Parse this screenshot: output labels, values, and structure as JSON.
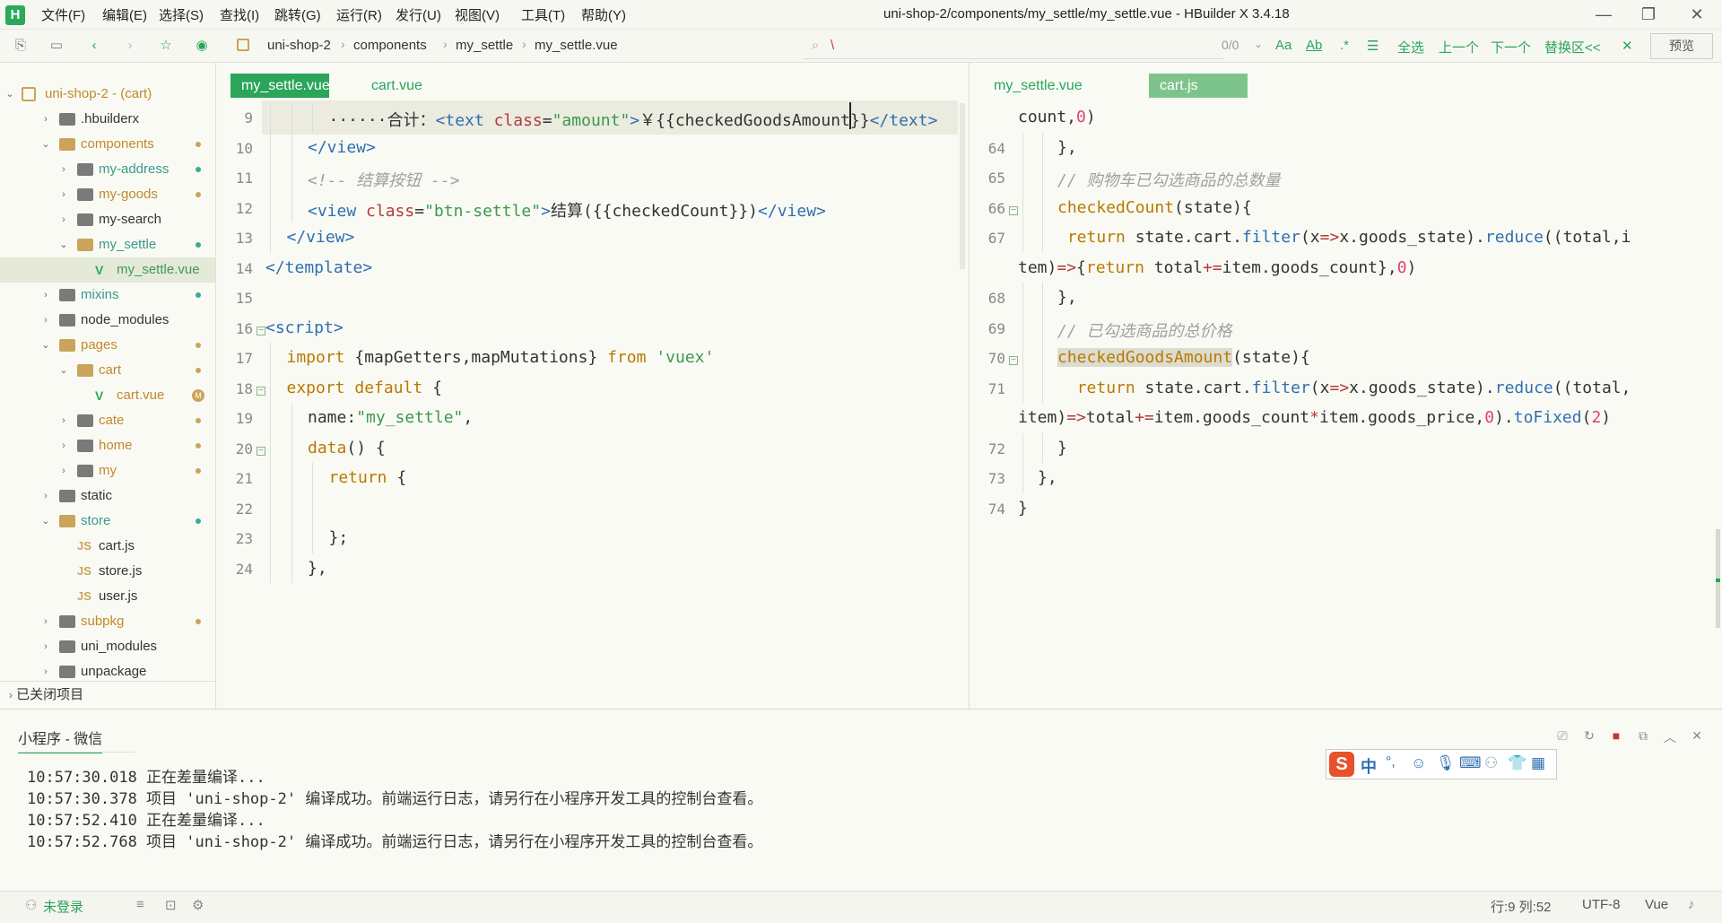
{
  "window": {
    "title": "uni-shop-2/components/my_settle/my_settle.vue - HBuilder X 3.4.18",
    "logo": "H",
    "menu": [
      "文件(F)",
      "编辑(E)",
      "选择(S)",
      "查找(I)",
      "跳转(G)",
      "运行(R)",
      "发行(U)",
      "视图(V)",
      "工具(T)",
      "帮助(Y)"
    ],
    "controls": {
      "minimize": "—",
      "maximize": "❐",
      "close": "✕"
    }
  },
  "toolbar": {
    "breadcrumb": [
      "uni-shop-2",
      "components",
      "my_settle",
      "my_settle.vue"
    ],
    "find": {
      "query": "\\",
      "count": "0/0",
      "case_label": "Aa",
      "word_label": "Ab",
      "regex_label": ".*",
      "select_all": "全选",
      "prev": "上一个",
      "next": "下一个",
      "replace_toggle": "替换区<<",
      "close": "✕"
    },
    "preview_label": "预览"
  },
  "sidebar": {
    "project": "uni-shop-2 - (cart)",
    "items": [
      {
        "label": ".hbuilderx",
        "type": "folder",
        "level": 1,
        "expanded": false,
        "dot": ""
      },
      {
        "label": "components",
        "type": "folder",
        "level": 1,
        "expanded": true,
        "dot": "#c9a45a",
        "color": "#c08a2a"
      },
      {
        "label": "my-address",
        "type": "folder",
        "level": 2,
        "expanded": false,
        "dot": "#3aaa9a",
        "color": "#3a9a8a"
      },
      {
        "label": "my-goods",
        "type": "folder",
        "level": 2,
        "expanded": false,
        "dot": "#c9a45a",
        "color": "#c08a2a"
      },
      {
        "label": "my-search",
        "type": "folder",
        "level": 2,
        "expanded": false,
        "dot": "",
        "color": "#333"
      },
      {
        "label": "my_settle",
        "type": "folder",
        "level": 2,
        "expanded": true,
        "dot": "#3aaa9a",
        "color": "#3a9a8a"
      },
      {
        "label": "my_settle.vue",
        "type": "vue",
        "level": 3,
        "dot": "",
        "color": "#3a9a5a",
        "selected": true
      },
      {
        "label": "mixins",
        "type": "folder",
        "level": 1,
        "expanded": false,
        "dot": "#3aaa9a",
        "color": "#3a9a8a"
      },
      {
        "label": "node_modules",
        "type": "folder",
        "level": 1,
        "expanded": false,
        "dot": "",
        "color": "#333"
      },
      {
        "label": "pages",
        "type": "folder",
        "level": 1,
        "expanded": true,
        "dot": "#c9a45a",
        "color": "#c08a2a"
      },
      {
        "label": "cart",
        "type": "folder",
        "level": 2,
        "expanded": true,
        "dot": "#c9a45a",
        "color": "#c08a2a"
      },
      {
        "label": "cart.vue",
        "type": "vue",
        "level": 3,
        "dot": "",
        "color": "#c08a2a",
        "badge": "M"
      },
      {
        "label": "cate",
        "type": "folder",
        "level": 2,
        "expanded": false,
        "dot": "#c9a45a",
        "color": "#c08a2a"
      },
      {
        "label": "home",
        "type": "folder",
        "level": 2,
        "expanded": false,
        "dot": "#c9a45a",
        "color": "#c08a2a"
      },
      {
        "label": "my",
        "type": "folder",
        "level": 2,
        "expanded": false,
        "dot": "#c9a45a",
        "color": "#c08a2a"
      },
      {
        "label": "static",
        "type": "folder",
        "level": 1,
        "expanded": false,
        "dot": "",
        "color": "#333"
      },
      {
        "label": "store",
        "type": "folder",
        "level": 1,
        "expanded": true,
        "dot": "#3aaa9a",
        "color": "#3a9a8a"
      },
      {
        "label": "cart.js",
        "type": "js",
        "level": 2,
        "dot": "",
        "color": "#333"
      },
      {
        "label": "store.js",
        "type": "js",
        "level": 2,
        "dot": "",
        "color": "#333"
      },
      {
        "label": "user.js",
        "type": "js",
        "level": 2,
        "dot": "",
        "color": "#333"
      },
      {
        "label": "subpkg",
        "type": "folder",
        "level": 1,
        "expanded": false,
        "dot": "#c9a45a",
        "color": "#c08a2a"
      },
      {
        "label": "uni_modules",
        "type": "folder",
        "level": 1,
        "expanded": false,
        "dot": "",
        "color": "#333"
      },
      {
        "label": "unpackage",
        "type": "folder",
        "level": 1,
        "expanded": false,
        "dot": "",
        "color": "#333"
      }
    ],
    "closed_projects": "已关闭项目"
  },
  "left_editor": {
    "tabs": [
      "my_settle.vue",
      "cart.vue"
    ],
    "active_tab": 0,
    "lines": [
      {
        "n": "9",
        "indent": 3,
        "fold": false,
        "highlight": true,
        "tokens": [
          [
            "c-plain",
            "······合计："
          ],
          [
            "c-tag",
            "<text "
          ],
          [
            "c-attr",
            "class"
          ],
          [
            "c-plain",
            "="
          ],
          [
            "c-str",
            "\"amount\""
          ],
          [
            "c-tag",
            ">"
          ],
          [
            "c-plain",
            "￥{{checkedGoodsAmount}}"
          ],
          [
            "c-tag",
            "</text>"
          ]
        ]
      },
      {
        "n": "10",
        "indent": 2,
        "tokens": [
          [
            "c-tag",
            "</view>"
          ]
        ]
      },
      {
        "n": "11",
        "indent": 2,
        "tokens": [
          [
            "c-com",
            "<!-- 结算按钮 -->"
          ]
        ]
      },
      {
        "n": "12",
        "indent": 2,
        "tokens": [
          [
            "c-tag",
            "<view "
          ],
          [
            "c-attr",
            "class"
          ],
          [
            "c-plain",
            "="
          ],
          [
            "c-str",
            "\"btn-settle\""
          ],
          [
            "c-tag",
            ">"
          ],
          [
            "c-plain",
            "结算({{checkedCount}})"
          ],
          [
            "c-tag",
            "</view>"
          ]
        ]
      },
      {
        "n": "13",
        "indent": 1,
        "tokens": [
          [
            "c-tag",
            "</view>"
          ]
        ]
      },
      {
        "n": "14",
        "indent": 0,
        "tokens": [
          [
            "c-tag",
            "</template>"
          ]
        ]
      },
      {
        "n": "15",
        "indent": 0,
        "tokens": []
      },
      {
        "n": "16",
        "indent": 0,
        "fold": true,
        "tokens": [
          [
            "c-tag",
            "<script>"
          ]
        ]
      },
      {
        "n": "17",
        "indent": 1,
        "tokens": [
          [
            "c-kw",
            "import "
          ],
          [
            "c-plain",
            "{mapGetters,mapMutations} "
          ],
          [
            "c-kw",
            "from "
          ],
          [
            "c-str",
            "'vuex'"
          ]
        ]
      },
      {
        "n": "18",
        "indent": 1,
        "fold": true,
        "tokens": [
          [
            "c-kw",
            "export default "
          ],
          [
            "c-plain",
            "{"
          ]
        ]
      },
      {
        "n": "19",
        "indent": 2,
        "tokens": [
          [
            "c-plain",
            "name:"
          ],
          [
            "c-str",
            "\"my_settle\""
          ],
          [
            "c-plain",
            ","
          ]
        ]
      },
      {
        "n": "20",
        "indent": 2,
        "fold": true,
        "tokens": [
          [
            "c-kw",
            "data"
          ],
          [
            "c-plain",
            "() {"
          ]
        ]
      },
      {
        "n": "21",
        "indent": 3,
        "tokens": [
          [
            "c-kw",
            "return "
          ],
          [
            "c-plain",
            "{"
          ]
        ]
      },
      {
        "n": "22",
        "indent": 3,
        "tokens": []
      },
      {
        "n": "23",
        "indent": 3,
        "tokens": [
          [
            "c-plain",
            "};"
          ]
        ]
      },
      {
        "n": "24",
        "indent": 2,
        "tokens": [
          [
            "c-plain",
            "},"
          ]
        ]
      }
    ]
  },
  "right_editor": {
    "tabs": [
      "my_settle.vue",
      "cart.js"
    ],
    "active_tab": 1,
    "lines": [
      {
        "n": "",
        "indent": 0,
        "tokens": [
          [
            "c-plain",
            "count,"
          ],
          [
            "c-num",
            "0"
          ],
          [
            "c-plain",
            ")"
          ]
        ]
      },
      {
        "n": "64",
        "indent": 2,
        "tokens": [
          [
            "c-plain",
            "},"
          ]
        ]
      },
      {
        "n": "65",
        "indent": 2,
        "tokens": [
          [
            "c-com",
            "// 购物车已勾选商品的总数量"
          ]
        ]
      },
      {
        "n": "66",
        "indent": 2,
        "fold": true,
        "tokens": [
          [
            "c-kw",
            "checkedCount"
          ],
          [
            "c-plain",
            "(state){"
          ]
        ]
      },
      {
        "n": "67",
        "indent": 2,
        "tokens": [
          [
            "c-plain",
            " "
          ],
          [
            "c-kw",
            "return "
          ],
          [
            "c-plain",
            "state.cart."
          ],
          [
            "c-fn",
            "filter"
          ],
          [
            "c-plain",
            "(x"
          ],
          [
            "c-op",
            "=>"
          ],
          [
            "c-plain",
            "x.goods_state)."
          ],
          [
            "c-fn",
            "reduce"
          ],
          [
            "c-plain",
            "((total,i"
          ]
        ]
      },
      {
        "n": "",
        "indent": 0,
        "tokens": [
          [
            "c-plain",
            "tem)"
          ],
          [
            "c-op",
            "=>"
          ],
          [
            "c-plain",
            "{"
          ],
          [
            "c-kw",
            "return "
          ],
          [
            "c-plain",
            "total"
          ],
          [
            "c-op",
            "+="
          ],
          [
            "c-plain",
            "item.goods_count},"
          ],
          [
            "c-num",
            "0"
          ],
          [
            "c-plain",
            ")"
          ]
        ]
      },
      {
        "n": "68",
        "indent": 2,
        "tokens": [
          [
            "c-plain",
            "},"
          ]
        ]
      },
      {
        "n": "69",
        "indent": 2,
        "tokens": [
          [
            "c-com",
            "// 已勾选商品的总价格"
          ]
        ]
      },
      {
        "n": "70",
        "indent": 2,
        "fold": true,
        "tokens": [
          [
            "c-kw hl-word",
            "checkedGoodsAmount"
          ],
          [
            "c-plain",
            "(state){"
          ]
        ]
      },
      {
        "n": "71",
        "indent": 2,
        "tokens": [
          [
            "c-plain",
            "  "
          ],
          [
            "c-kw",
            "return "
          ],
          [
            "c-plain",
            "state.cart."
          ],
          [
            "c-fn",
            "filter"
          ],
          [
            "c-plain",
            "(x"
          ],
          [
            "c-op",
            "=>"
          ],
          [
            "c-plain",
            "x.goods_state)."
          ],
          [
            "c-fn",
            "reduce"
          ],
          [
            "c-plain",
            "((total,"
          ]
        ]
      },
      {
        "n": "",
        "indent": 0,
        "tokens": [
          [
            "c-plain",
            "item)"
          ],
          [
            "c-op",
            "=>"
          ],
          [
            "c-plain",
            "total"
          ],
          [
            "c-op",
            "+="
          ],
          [
            "c-plain",
            "item.goods_count"
          ],
          [
            "c-op",
            "*"
          ],
          [
            "c-plain",
            "item.goods_price,"
          ],
          [
            "c-num",
            "0"
          ],
          [
            "c-plain",
            ")."
          ],
          [
            "c-fn",
            "toFixed"
          ],
          [
            "c-plain",
            "("
          ],
          [
            "c-num",
            "2"
          ],
          [
            "c-plain",
            ")"
          ]
        ]
      },
      {
        "n": "72",
        "indent": 2,
        "tokens": [
          [
            "c-plain",
            "}"
          ]
        ]
      },
      {
        "n": "73",
        "indent": 1,
        "tokens": [
          [
            "c-plain",
            "},"
          ]
        ]
      },
      {
        "n": "74",
        "indent": 0,
        "tokens": [
          [
            "c-plain",
            "}"
          ]
        ]
      }
    ]
  },
  "console": {
    "tab_label": "小程序 - 微信",
    "logs": [
      "10:57:30.018 正在差量编译...",
      "10:57:30.378 项目 'uni-shop-2' 编译成功。前端运行日志，请另行在小程序开发工具的控制台查看。",
      "10:57:52.410 正在差量编译...",
      "10:57:52.768 项目 'uni-shop-2' 编译成功。前端运行日志，请另行在小程序开发工具的控制台查看。"
    ],
    "ime": {
      "logo": "S",
      "mode": "中",
      "punct": "°,"
    }
  },
  "statusbar": {
    "login": "未登录",
    "position": "行:9  列:52",
    "encoding": "UTF-8",
    "language": "Vue"
  }
}
